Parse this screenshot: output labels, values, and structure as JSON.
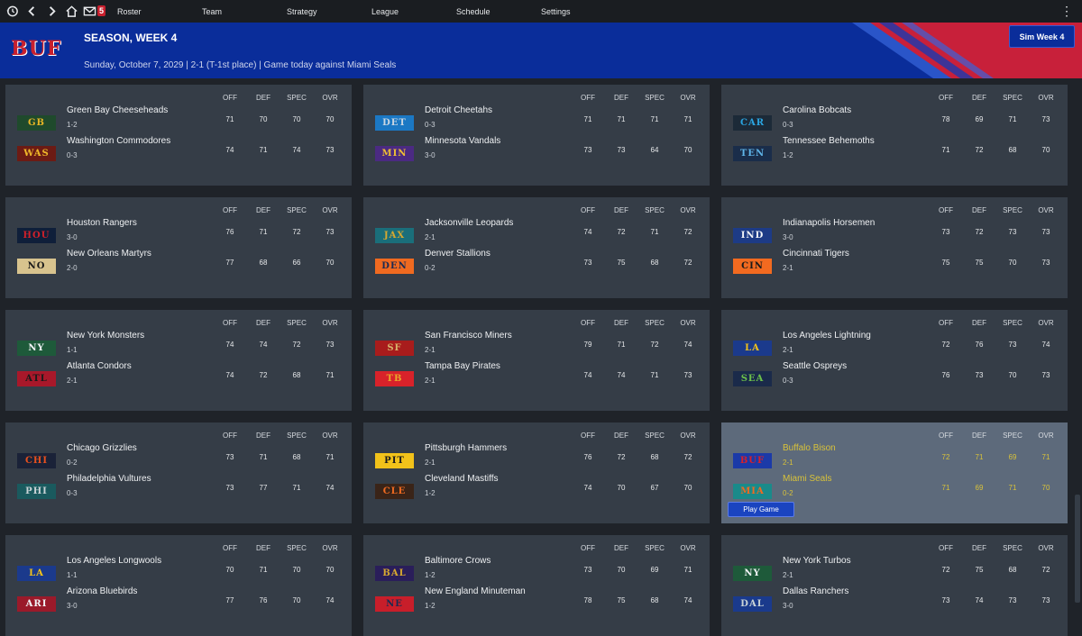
{
  "nav": {
    "mail_count": "5",
    "links": [
      "Roster",
      "Team",
      "Strategy",
      "League",
      "Schedule",
      "Settings"
    ]
  },
  "header": {
    "team_logo_text": "BUF",
    "title": "SEASON, WEEK 4",
    "subtitle": "Sunday, October 7, 2029 | 2-1 (T-1st place) | Game today against Miami Seals",
    "sim_button": "Sim Week 4"
  },
  "stat_headers": [
    "OFF",
    "DEF",
    "SPEC",
    "OVR"
  ],
  "play_game_label": "Play Game",
  "games": [
    {
      "teams": [
        {
          "abbr": "GB",
          "name": "Green Bay Cheeseheads",
          "record": "1-2",
          "stats": [
            "71",
            "70",
            "70",
            "70"
          ],
          "bg": "#1f4a2c",
          "fg": "#e9b625"
        },
        {
          "abbr": "WAS",
          "name": "Washington Commodores",
          "record": "0-3",
          "stats": [
            "74",
            "71",
            "74",
            "73"
          ],
          "bg": "#6c1b14",
          "fg": "#f0b82a"
        }
      ]
    },
    {
      "teams": [
        {
          "abbr": "DET",
          "name": "Detroit Cheetahs",
          "record": "0-3",
          "stats": [
            "71",
            "71",
            "71",
            "71"
          ],
          "bg": "#1b78c4",
          "fg": "#c9d6e2"
        },
        {
          "abbr": "MIN",
          "name": "Minnesota Vandals",
          "record": "3-0",
          "stats": [
            "73",
            "73",
            "64",
            "70"
          ],
          "bg": "#4b2a82",
          "fg": "#f0c033"
        }
      ]
    },
    {
      "teams": [
        {
          "abbr": "CAR",
          "name": "Carolina Bobcats",
          "record": "0-3",
          "stats": [
            "78",
            "69",
            "71",
            "73"
          ],
          "bg": "#1c2a38",
          "fg": "#2aa4e0"
        },
        {
          "abbr": "TEN",
          "name": "Tennessee Behemoths",
          "record": "1-2",
          "stats": [
            "71",
            "72",
            "68",
            "70"
          ],
          "bg": "#1a2d4a",
          "fg": "#5fb4e8"
        }
      ]
    },
    {
      "teams": [
        {
          "abbr": "HOU",
          "name": "Houston Rangers",
          "record": "3-0",
          "stats": [
            "76",
            "71",
            "72",
            "73"
          ],
          "bg": "#0f1f3a",
          "fg": "#d0202a"
        },
        {
          "abbr": "NO",
          "name": "New Orleans Martyrs",
          "record": "2-0",
          "stats": [
            "77",
            "68",
            "66",
            "70"
          ],
          "bg": "#d8c38e",
          "fg": "#1a1a1a"
        }
      ]
    },
    {
      "teams": [
        {
          "abbr": "JAX",
          "name": "Jacksonville Leopards",
          "record": "2-1",
          "stats": [
            "74",
            "72",
            "71",
            "72"
          ],
          "bg": "#1a6e7a",
          "fg": "#d6a830"
        },
        {
          "abbr": "DEN",
          "name": "Denver Stallions",
          "record": "0-2",
          "stats": [
            "73",
            "75",
            "68",
            "72"
          ],
          "bg": "#f06a20",
          "fg": "#1b2a52"
        }
      ]
    },
    {
      "teams": [
        {
          "abbr": "IND",
          "name": "Indianapolis Horsemen",
          "record": "3-0",
          "stats": [
            "73",
            "72",
            "73",
            "73"
          ],
          "bg": "#1d3b86",
          "fg": "#f2f4f7"
        },
        {
          "abbr": "CIN",
          "name": "Cincinnati Tigers",
          "record": "2-1",
          "stats": [
            "75",
            "75",
            "70",
            "73"
          ],
          "bg": "#f26a20",
          "fg": "#1a1a1a"
        }
      ]
    },
    {
      "teams": [
        {
          "abbr": "NY",
          "name": "New York Monsters",
          "record": "1-1",
          "stats": [
            "74",
            "74",
            "72",
            "73"
          ],
          "bg": "#1e5a3a",
          "fg": "#f2f4f7"
        },
        {
          "abbr": "ATL",
          "name": "Atlanta Condors",
          "record": "2-1",
          "stats": [
            "74",
            "72",
            "68",
            "71"
          ],
          "bg": "#a8182a",
          "fg": "#1a1a1a"
        }
      ]
    },
    {
      "teams": [
        {
          "abbr": "SF",
          "name": "San Francisco Miners",
          "record": "2-1",
          "stats": [
            "79",
            "71",
            "72",
            "74"
          ],
          "bg": "#a81c1c",
          "fg": "#d6b46a"
        },
        {
          "abbr": "TB",
          "name": "Tampa Bay Pirates",
          "record": "2-1",
          "stats": [
            "74",
            "74",
            "71",
            "73"
          ],
          "bg": "#d8222a",
          "fg": "#e8a62a"
        }
      ]
    },
    {
      "teams": [
        {
          "abbr": "LA",
          "name": "Los Angeles Lightning",
          "record": "2-1",
          "stats": [
            "72",
            "76",
            "73",
            "74"
          ],
          "bg": "#1b3a8c",
          "fg": "#f2c21a"
        },
        {
          "abbr": "SEA",
          "name": "Seattle Ospreys",
          "record": "0-3",
          "stats": [
            "76",
            "73",
            "70",
            "73"
          ],
          "bg": "#1a2a4a",
          "fg": "#6cc04a"
        }
      ]
    },
    {
      "teams": [
        {
          "abbr": "CHI",
          "name": "Chicago Grizzlies",
          "record": "0-2",
          "stats": [
            "73",
            "71",
            "68",
            "71"
          ],
          "bg": "#1a2238",
          "fg": "#e8501e"
        },
        {
          "abbr": "PHI",
          "name": "Philadelphia Vultures",
          "record": "0-3",
          "stats": [
            "73",
            "77",
            "71",
            "74"
          ],
          "bg": "#1a5a5e",
          "fg": "#c9d3d6"
        }
      ]
    },
    {
      "teams": [
        {
          "abbr": "PIT",
          "name": "Pittsburgh Hammers",
          "record": "2-1",
          "stats": [
            "76",
            "72",
            "68",
            "72"
          ],
          "bg": "#f2c21a",
          "fg": "#1a1a1a"
        },
        {
          "abbr": "CLE",
          "name": "Cleveland Mastiffs",
          "record": "1-2",
          "stats": [
            "74",
            "70",
            "67",
            "70"
          ],
          "bg": "#3a2418",
          "fg": "#f06a20"
        }
      ]
    },
    {
      "highlight": true,
      "teams": [
        {
          "abbr": "BUF",
          "name": "Buffalo Bison",
          "record": "2-1",
          "stats": [
            "72",
            "71",
            "69",
            "71"
          ],
          "bg": "#1b3aa8",
          "fg": "#d8202a"
        },
        {
          "abbr": "MIA",
          "name": "Miami Seals",
          "record": "0-2",
          "stats": [
            "71",
            "69",
            "71",
            "70"
          ],
          "bg": "#1a8a8a",
          "fg": "#f06a20"
        }
      ]
    },
    {
      "teams": [
        {
          "abbr": "LA",
          "name": "Los Angeles Longwools",
          "record": "1-1",
          "stats": [
            "70",
            "71",
            "70",
            "70"
          ],
          "bg": "#1b3a8c",
          "fg": "#f2c21a"
        },
        {
          "abbr": "ARI",
          "name": "Arizona Bluebirds",
          "record": "3-0",
          "stats": [
            "77",
            "76",
            "70",
            "74"
          ],
          "bg": "#9a1a2a",
          "fg": "#f2f4f7"
        }
      ]
    },
    {
      "teams": [
        {
          "abbr": "BAL",
          "name": "Baltimore Crows",
          "record": "1-2",
          "stats": [
            "73",
            "70",
            "69",
            "71"
          ],
          "bg": "#2a1e5a",
          "fg": "#d6a830"
        },
        {
          "abbr": "NE",
          "name": "New England Minuteman",
          "record": "1-2",
          "stats": [
            "78",
            "75",
            "68",
            "74"
          ],
          "bg": "#c81e2a",
          "fg": "#1a2a52"
        }
      ]
    },
    {
      "teams": [
        {
          "abbr": "NY",
          "name": "New York Turbos",
          "record": "2-1",
          "stats": [
            "72",
            "75",
            "68",
            "72"
          ],
          "bg": "#1e5a3a",
          "fg": "#f2f4f7"
        },
        {
          "abbr": "DAL",
          "name": "Dallas Ranchers",
          "record": "3-0",
          "stats": [
            "73",
            "74",
            "73",
            "73"
          ],
          "bg": "#1a3a8c",
          "fg": "#c9d3d6"
        }
      ]
    }
  ]
}
